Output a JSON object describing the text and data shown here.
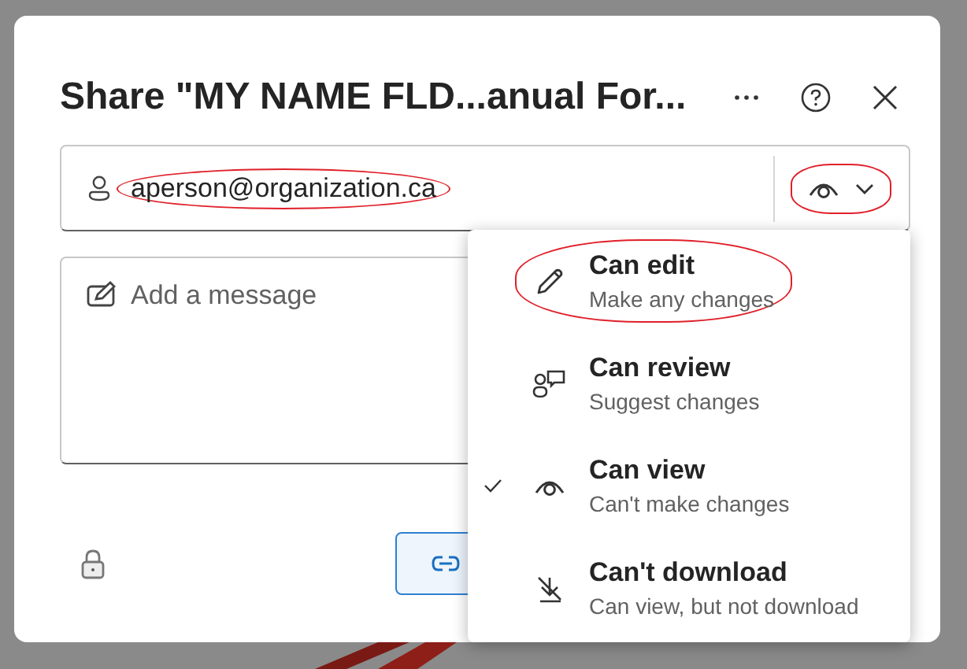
{
  "dialog": {
    "title": "Share \"MY NAME FLD...anual For...",
    "recipient_field": {
      "value": "aperson@organization.ca",
      "circled": true
    },
    "permission_button": {
      "circled": true
    },
    "message_field": {
      "placeholder": "Add a message"
    },
    "permission_menu": [
      {
        "label": "Can edit",
        "description": "Make any changes",
        "selected": false,
        "circled": true,
        "kind": "edit"
      },
      {
        "label": "Can review",
        "description": "Suggest changes",
        "selected": false,
        "circled": false,
        "kind": "review"
      },
      {
        "label": "Can view",
        "description": "Can't make changes",
        "selected": true,
        "circled": false,
        "kind": "view"
      },
      {
        "label": "Can't download",
        "description": "Can view, but not download",
        "selected": false,
        "circled": false,
        "kind": "nodownload"
      }
    ]
  }
}
